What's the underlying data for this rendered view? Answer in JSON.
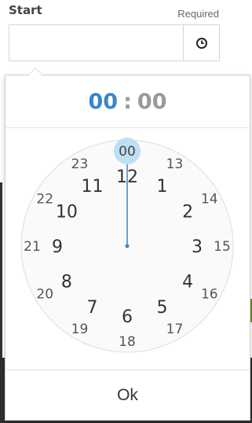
{
  "field": {
    "label": "Start",
    "required_text": "Required",
    "value": ""
  },
  "time": {
    "hours": "00",
    "separator": ":",
    "minutes": "00"
  },
  "clock": {
    "outer_hours": [
      "12",
      "1",
      "2",
      "3",
      "4",
      "5",
      "6",
      "7",
      "8",
      "9",
      "10",
      "11"
    ],
    "inner_hours": [
      "00",
      "13",
      "14",
      "15",
      "16",
      "17",
      "18",
      "19",
      "20",
      "21",
      "22",
      "23"
    ],
    "selected": "00",
    "accent_color": "#3a86c8",
    "highlight_color": "#bfe0f4"
  },
  "footer": {
    "ok_label": "Ok"
  },
  "icons": {
    "time_icon": "clock-icon"
  }
}
